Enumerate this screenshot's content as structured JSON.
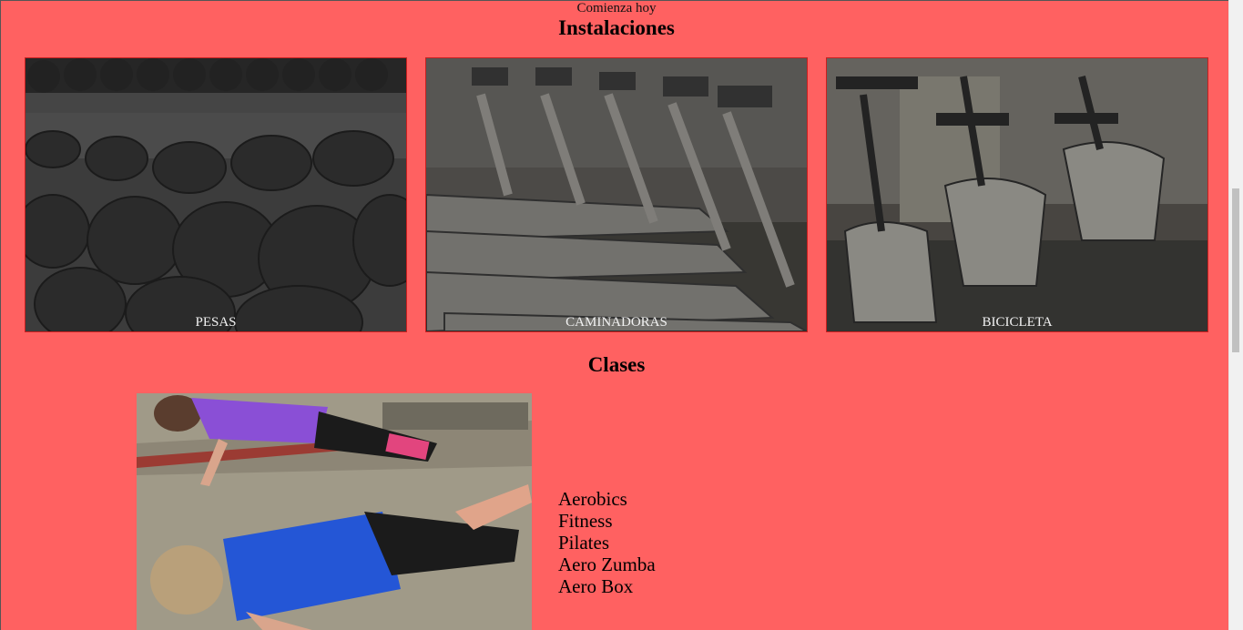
{
  "header": {
    "tagline": "Comienza hoy"
  },
  "facilities": {
    "title": "Instalaciones",
    "items": [
      {
        "label": "PESAS"
      },
      {
        "label": "CAMINADORAS"
      },
      {
        "label": "BICICLETA"
      }
    ]
  },
  "classes": {
    "title": "Clases",
    "items": [
      "Aerobics",
      "Fitness",
      "Pilates",
      "Aero Zumba",
      "Aero Box"
    ]
  },
  "colors": {
    "background": "#ff6161",
    "card_border": "#c91f1f",
    "label_text": "#f2f2f2"
  }
}
